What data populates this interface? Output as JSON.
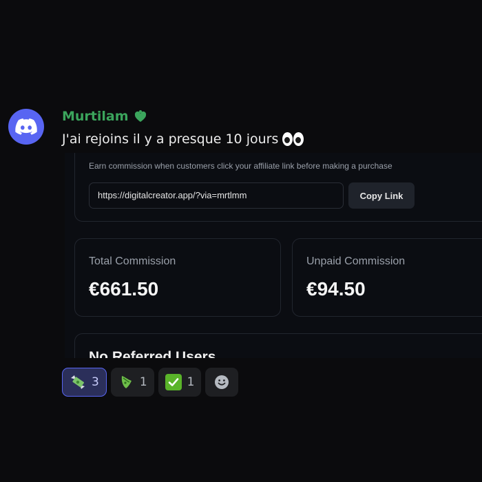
{
  "message": {
    "author": "Murtilam",
    "author_color": "#3ba55c",
    "text": "J'ai rejoins il y a presque 10 jours",
    "avatar_color": "#5865f2"
  },
  "embed": {
    "description": "Earn commission when customers click your affiliate link before making a purchase",
    "affiliate_link": "https://digitalcreator.app/?via=mrtlmm",
    "copy_button": "Copy Link",
    "total_commission_label": "Total Commission",
    "total_commission_value": "€661.50",
    "unpaid_commission_label": "Unpaid Commission",
    "unpaid_commission_value": "€94.50",
    "referred_title": "No Referred Users"
  },
  "reactions": [
    {
      "icon": "money-with-wings-emoji",
      "count": "3",
      "active": true
    },
    {
      "icon": "money-bag-emoji",
      "count": "1",
      "active": false
    },
    {
      "icon": "check-mark-emoji",
      "count": "1",
      "active": false
    },
    {
      "icon": "add-reaction-icon",
      "count": null,
      "active": false
    }
  ]
}
